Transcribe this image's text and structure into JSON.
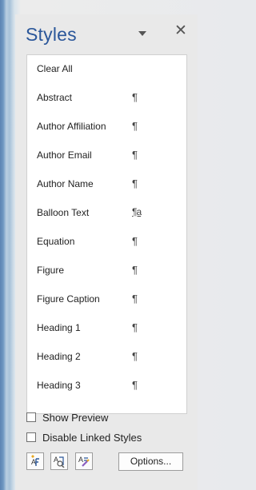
{
  "pane": {
    "title": "Styles",
    "icons": {
      "dropdown": "chevron-down-icon",
      "close": "close-icon"
    }
  },
  "styles_list": {
    "items": [
      {
        "label": "Clear All",
        "mark": ""
      },
      {
        "label": "Abstract",
        "mark": "¶"
      },
      {
        "label": "Author Affiliation",
        "mark": "¶"
      },
      {
        "label": "Author Email",
        "mark": "¶"
      },
      {
        "label": "Author Name",
        "mark": "¶"
      },
      {
        "label": "Balloon Text",
        "mark": "¶a"
      },
      {
        "label": "Equation",
        "mark": "¶"
      },
      {
        "label": "Figure",
        "mark": "¶"
      },
      {
        "label": "Figure Caption",
        "mark": "¶"
      },
      {
        "label": "Heading 1",
        "mark": "¶"
      },
      {
        "label": "Heading 2",
        "mark": "¶"
      },
      {
        "label": "Heading 3",
        "mark": "¶"
      }
    ]
  },
  "options": {
    "show_preview": {
      "label": "Show Preview",
      "checked": false
    },
    "disable_linked_styles": {
      "label": "Disable Linked Styles",
      "checked": false
    }
  },
  "toolbar": {
    "new_style_icon": "new-style-icon",
    "style_inspector_icon": "style-inspector-icon",
    "manage_styles_icon": "manage-styles-icon",
    "options_label": "Options..."
  }
}
